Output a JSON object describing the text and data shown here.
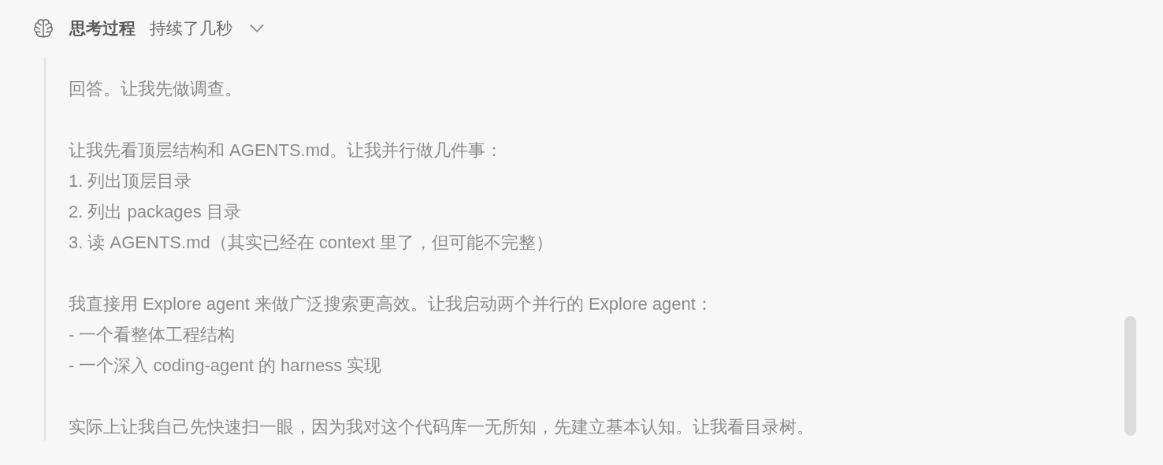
{
  "header": {
    "title": "思考过程",
    "duration": "持续了几秒",
    "expanded": true
  },
  "paragraphs": [
    {
      "lines": [
        "回答。让我先做调查。"
      ]
    },
    {
      "lines": [
        "让我先看顶层结构和 AGENTS.md。让我并行做几件事：",
        "1. 列出顶层目录",
        "2. 列出 packages 目录",
        "3. 读 AGENTS.md（其实已经在 context 里了，但可能不完整）"
      ]
    },
    {
      "lines": [
        "我直接用 Explore agent 来做广泛搜索更高效。让我启动两个并行的 Explore agent：",
        "- 一个看整体工程结构",
        "- 一个深入 coding-agent 的 harness 实现"
      ]
    },
    {
      "lines": [
        "实际上让我自己先快速扫一眼，因为我对这个代码库一无所知，先建立基本认知。让我看目录树。"
      ]
    }
  ]
}
